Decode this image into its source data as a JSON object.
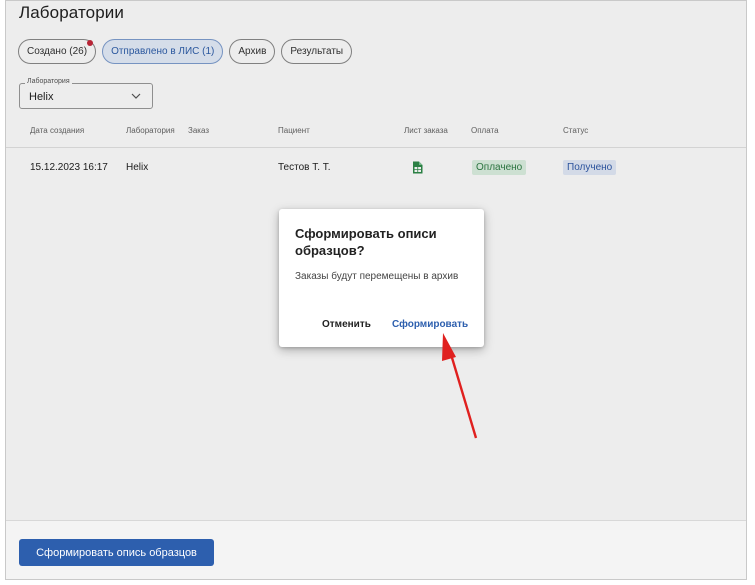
{
  "page": {
    "title": "Лаборатории"
  },
  "tabs": [
    {
      "label": "Создано (26)",
      "active": false,
      "has_notification": true
    },
    {
      "label": "Отправлено в ЛИС (1)",
      "active": true,
      "has_notification": false
    },
    {
      "label": "Архив",
      "active": false,
      "has_notification": false
    },
    {
      "label": "Результаты",
      "active": false,
      "has_notification": false
    }
  ],
  "filter": {
    "legend": "Лаборатория",
    "value": "Helix"
  },
  "table": {
    "columns": [
      "Дата создания",
      "Лаборатория",
      "Заказ",
      "Пациент",
      "Лист заказа",
      "Оплата",
      "Статус"
    ],
    "rows": [
      {
        "created": "15.12.2023 16:17",
        "lab": "Helix",
        "order": "",
        "patient": "Тестов Т. Т.",
        "sheet_icon": "spreadsheet-icon",
        "payment": "Оплачено",
        "status": "Получено"
      }
    ]
  },
  "dialog": {
    "title": "Сформировать описи образцов?",
    "body": "Заказы будут перемещены в архив",
    "cancel_label": "Отменить",
    "confirm_label": "Сформировать"
  },
  "footer": {
    "primary_label": "Сформировать опись образцов"
  },
  "colors": {
    "primary": "#2d5fae",
    "paid_bg": "#ddf1e2",
    "paid_text": "#2f7d45",
    "received_bg": "#e4ebf9",
    "received_text": "#2e59a8",
    "annotation_arrow": "#e0201f",
    "notification_dot": "#c6283b"
  },
  "icons": [
    "chevron-down-icon",
    "spreadsheet-icon",
    "annotation-arrow-icon"
  ]
}
